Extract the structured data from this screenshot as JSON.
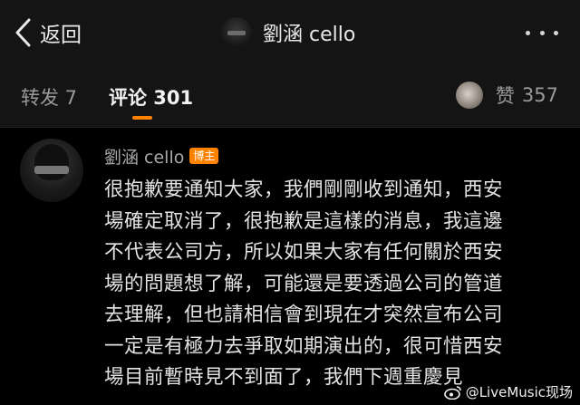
{
  "nav": {
    "back_label": "返回",
    "title": "劉涵 cello"
  },
  "tabs": {
    "repost": "转发 7",
    "comment": "评论 301",
    "like_label": "赞",
    "like_count": "357"
  },
  "comment": {
    "author": "劉涵 cello",
    "badge": "博主",
    "lines": [
      "很抱歉要通知大家，我們剛剛收到通知，西安",
      "場確定取消了，很抱歉是這樣的消息，我這邊",
      "不代表公司方，所以如果大家有任何關於西安",
      "場的問題想了解，可能還是要透過公司的管道",
      "去理解，但也請相信會到現在才突然宣布公司",
      "一定是有極力去爭取如期演出的，很可惜西安",
      "場目前暫時見不到面了，我們下週重慶見"
    ]
  },
  "watermark": {
    "text": "@LiveMusic现场"
  },
  "colors": {
    "accent": "#ff8200",
    "background": "#000000",
    "header_bg": "#141414"
  }
}
